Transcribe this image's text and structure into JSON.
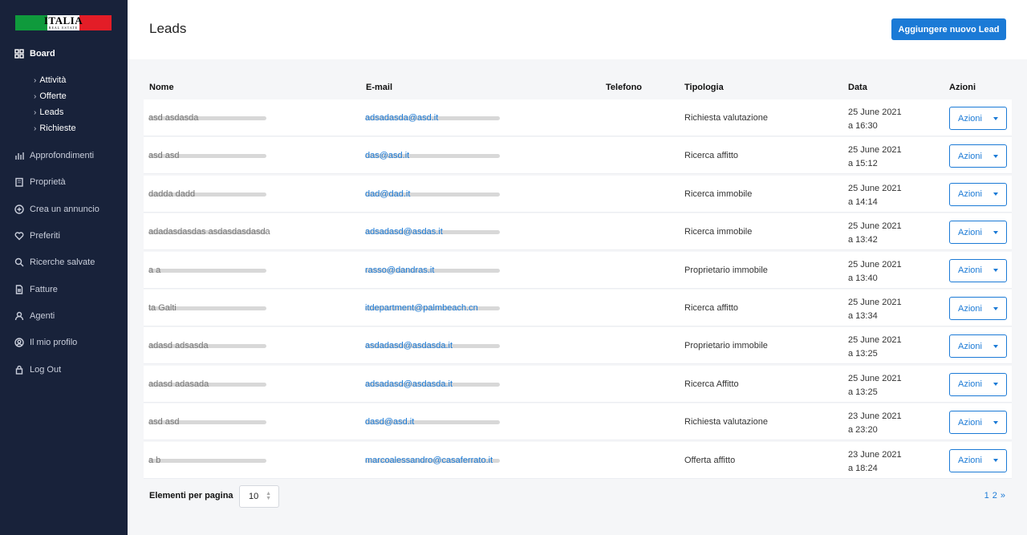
{
  "brand": {
    "logo_text": "ITALIA",
    "logo_sub": "REAL ESTATE"
  },
  "sidebar": {
    "board": "Board",
    "sub_items": [
      "Attività",
      "Offerte",
      "Leads",
      "Richieste"
    ],
    "items": [
      {
        "label": "Approfondimenti",
        "icon": "bar-chart-icon"
      },
      {
        "label": "Proprietà",
        "icon": "building-icon"
      },
      {
        "label": "Crea un annuncio",
        "icon": "plus-circle-icon"
      },
      {
        "label": "Preferiti",
        "icon": "heart-icon"
      },
      {
        "label": "Ricerche salvate",
        "icon": "search-icon"
      },
      {
        "label": "Fatture",
        "icon": "invoice-icon"
      },
      {
        "label": "Agenti",
        "icon": "user-icon"
      },
      {
        "label": "Il mio profilo",
        "icon": "profile-icon"
      },
      {
        "label": "Log Out",
        "icon": "lock-icon"
      }
    ]
  },
  "header": {
    "title": "Leads",
    "add_button": "Aggiungere nuovo Lead"
  },
  "table": {
    "columns": [
      "Nome",
      "E-mail",
      "Telefono",
      "Tipologia",
      "Data",
      "Azioni"
    ],
    "action_label": "Azioni",
    "rows": [
      {
        "name": "asd asdasda",
        "email": "adsadasda@asd.it",
        "type": "Richiesta valutazione",
        "date": "25 June 2021",
        "time": "a 16:30"
      },
      {
        "name": "asd asd",
        "email": "das@asd.it",
        "type": "Ricerca affitto",
        "date": "25 June 2021",
        "time": "a 15:12"
      },
      {
        "name": "dadda dadd",
        "email": "dad@dad.it",
        "type": "Ricerca immobile",
        "date": "25 June 2021",
        "time": "a 14:14"
      },
      {
        "name": "adadasdasdas asdasdasdasda",
        "email": "adsadasd@asdas.it",
        "type": "Ricerca immobile",
        "date": "25 June 2021",
        "time": "a 13:42"
      },
      {
        "name": "a a",
        "email": "rasso@dandras.it",
        "type": "Proprietario immobile",
        "date": "25 June 2021",
        "time": "a 13:40"
      },
      {
        "name": "ta Galti",
        "email": "itdepartment@palmbeach.cn",
        "type": "Ricerca affitto",
        "date": "25 June 2021",
        "time": "a 13:34"
      },
      {
        "name": "adasd adsasda",
        "email": "asdadasd@asdasda.it",
        "type": "Proprietario immobile",
        "date": "25 June 2021",
        "time": "a 13:25"
      },
      {
        "name": "adasd adasada",
        "email": "adsadasd@asdasda.it",
        "type": "Ricerca Affitto",
        "date": "25 June 2021",
        "time": "a 13:25"
      },
      {
        "name": "asd asd",
        "email": "dasd@asd.it",
        "type": "Richiesta valutazione",
        "date": "23 June 2021",
        "time": "a 23:20"
      },
      {
        "name": "a b",
        "email": "marcoalessandro@casaferrato.it",
        "type": "Offerta affitto",
        "date": "23 June 2021",
        "time": "a 18:24"
      }
    ]
  },
  "footer": {
    "per_page_label": "Elementi per pagina",
    "per_page_value": "10",
    "pages": [
      "1",
      "2",
      "»"
    ]
  },
  "colors": {
    "sidebar": "#18223a",
    "accent": "#1b7ad6"
  }
}
